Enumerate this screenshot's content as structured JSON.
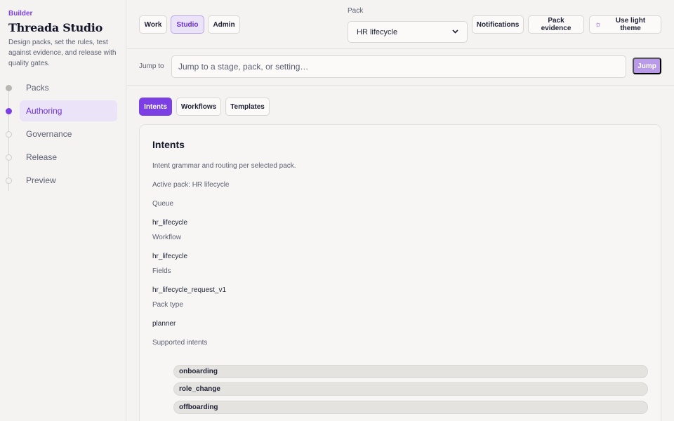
{
  "sidebar": {
    "eyebrow": "Builder",
    "title": "Threada Studio",
    "description": "Design packs, set the rules, test against evidence, and release with quality gates.",
    "items": [
      {
        "label": "Packs",
        "state": "done"
      },
      {
        "label": "Authoring",
        "state": "active"
      },
      {
        "label": "Governance",
        "state": "pending"
      },
      {
        "label": "Release",
        "state": "pending"
      },
      {
        "label": "Preview",
        "state": "pending"
      }
    ]
  },
  "topbar": {
    "modes": [
      "Work",
      "Studio",
      "Admin"
    ],
    "selected_mode": "Studio",
    "pack_label": "Pack",
    "pack_value": "HR lifecycle",
    "notifications": "Notifications",
    "pack_evidence": "Pack evidence",
    "theme_toggle": "Use light theme"
  },
  "jump": {
    "label": "Jump to",
    "placeholder": "Jump to a stage, pack, or setting…",
    "button": "Jump"
  },
  "tabs": [
    "Intents",
    "Workflows",
    "Templates"
  ],
  "active_tab": "Intents",
  "card": {
    "title": "Intents",
    "description": "Intent grammar and routing per selected pack.",
    "active_pack": "Active pack: HR lifecycle",
    "queue_label": "Queue",
    "queue_value": "hr_lifecycle",
    "workflow_label": "Workflow",
    "workflow_value": "hr_lifecycle",
    "fields_label": "Fields",
    "fields_value": "hr_lifecycle_request_v1",
    "pack_type_label": "Pack type",
    "pack_type_value": "planner",
    "supported_label": "Supported intents",
    "supported": [
      "onboarding",
      "role_change",
      "offboarding"
    ]
  },
  "colors": {
    "accent": "#7b3fe4",
    "accent_soft": "#ebe4f8",
    "background": "#f4f3f1"
  },
  "icons": {
    "theme": "sun-icon",
    "select": "chevron-down-icon"
  }
}
